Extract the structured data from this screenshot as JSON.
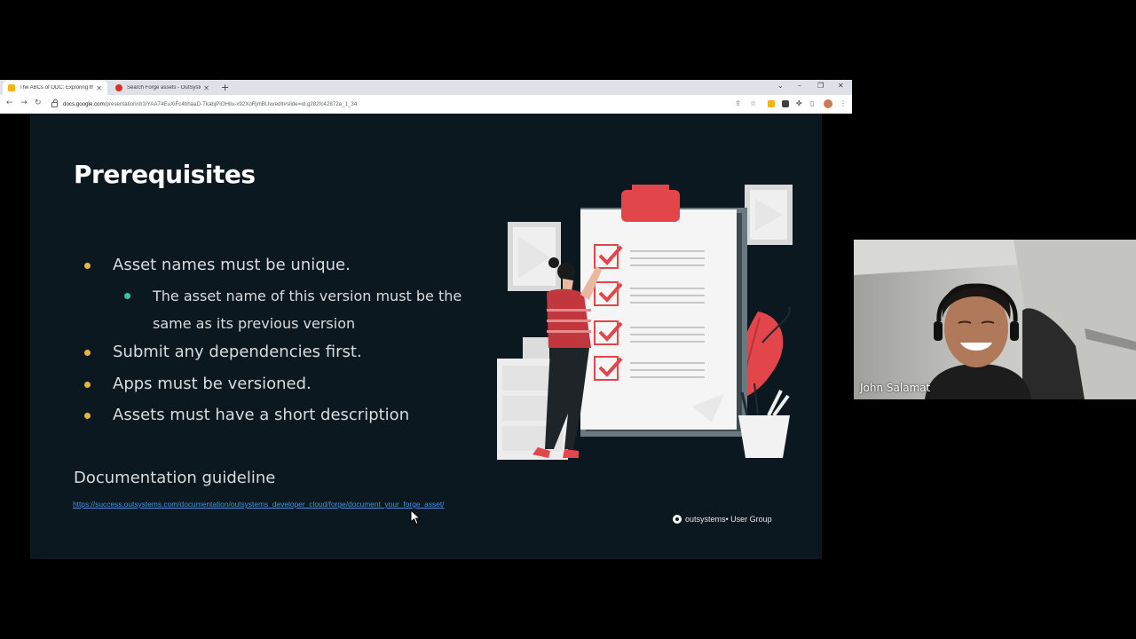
{
  "browser": {
    "tabs": [
      {
        "label": "The ABCs of ODC: Exploring the",
        "active": true,
        "favicon_color": "#f4b400"
      },
      {
        "label": "Search Forge assets - OutSyste",
        "active": false,
        "favicon_color": "#d93025"
      }
    ],
    "new_tab_label": "+",
    "url_host": "docs.google.com",
    "url_path": "/presentation/d/1IYAA74EuXiFc4bhaaD-TkabjPiOHilu-x92XoRjmBUw/edit#slide=id.g282fc42872a_1_34"
  },
  "slide": {
    "title": "Prerequisites",
    "bullets": {
      "b1": "Asset names must be unique.",
      "b1_sub_line1": "The asset name of this version must be the",
      "b1_sub_line2": "same as its previous version",
      "b2": "Submit any dependencies first.",
      "b3": "Apps must be versioned.",
      "b4": "Assets must have a short description"
    },
    "doc_heading": "Documentation guideline",
    "doc_link": "https://success.outsystems.com/documentation/outsystems_developer_cloud/forge/document_your_forge_asset/",
    "brand_name": "outsystems",
    "brand_suffix": " • User Group",
    "accent_colors": {
      "bullet_primary": "#e8b63f",
      "bullet_secondary": "#39c6a7",
      "illustration_red": "#e2454a"
    }
  },
  "webcam": {
    "participant_name": "John Salamat"
  }
}
